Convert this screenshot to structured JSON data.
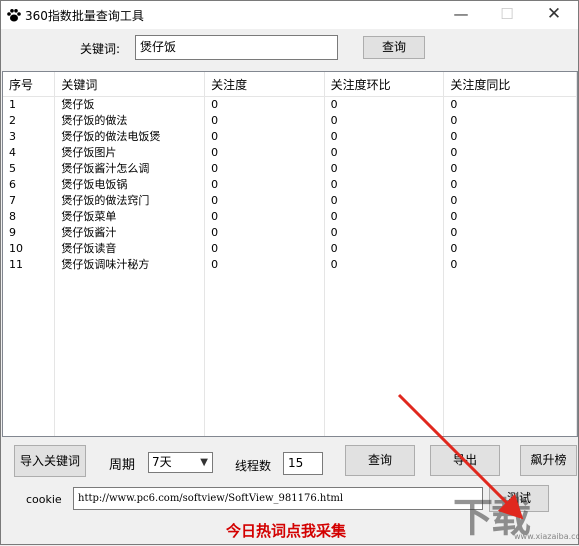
{
  "window": {
    "title": "360指数批量查询工具",
    "minimize": "—",
    "maximize": "☐",
    "close": "✕"
  },
  "search": {
    "label": "关键词:",
    "value": "煲仔饭",
    "button": "查询"
  },
  "table": {
    "headers": [
      "序号",
      "关键词",
      "关注度",
      "关注度环比",
      "关注度同比"
    ],
    "rows": [
      [
        "1",
        "煲仔饭",
        "0",
        "0",
        "0"
      ],
      [
        "2",
        "煲仔饭的做法",
        "0",
        "0",
        "0"
      ],
      [
        "3",
        "煲仔饭的做法电饭煲",
        "0",
        "0",
        "0"
      ],
      [
        "4",
        "煲仔饭图片",
        "0",
        "0",
        "0"
      ],
      [
        "5",
        "煲仔饭酱汁怎么调",
        "0",
        "0",
        "0"
      ],
      [
        "6",
        "煲仔饭电饭锅",
        "0",
        "0",
        "0"
      ],
      [
        "7",
        "煲仔饭的做法窍门",
        "0",
        "0",
        "0"
      ],
      [
        "8",
        "煲仔饭菜单",
        "0",
        "0",
        "0"
      ],
      [
        "9",
        "煲仔饭酱汁",
        "0",
        "0",
        "0"
      ],
      [
        "10",
        "煲仔饭读音",
        "0",
        "0",
        "0"
      ],
      [
        "11",
        "煲仔饭调味汁秘方",
        "0",
        "0",
        "0"
      ]
    ]
  },
  "controls": {
    "import_button": "导入关键词",
    "period_label": "周期",
    "period_value": "7天",
    "threads_label": "线程数",
    "threads_value": "15",
    "query_button": "查询",
    "export_button": "导出",
    "rise_button": "飙升榜",
    "cookie_label": "cookie",
    "cookie_value": "http://www.pc6.com/softview/SoftView_981176.html",
    "test_button": "测试"
  },
  "banner": "今日热词点我采集",
  "watermark": {
    "logo": "下载",
    "url": "www.xiazaiba.com"
  },
  "colors": {
    "banner": "#d30000",
    "arrow": "#e0281e"
  }
}
